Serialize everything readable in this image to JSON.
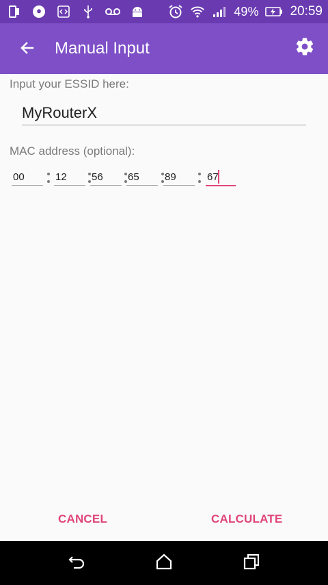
{
  "status_bar": {
    "battery": "49%",
    "time": "20:59",
    "left_icons": [
      "phone-icon",
      "soccer-ball-icon",
      "code-icon",
      "usb-icon",
      "voicemail-icon",
      "android-icon"
    ],
    "right_icons": [
      "alarm-icon",
      "wifi-icon",
      "signal-icon",
      "battery-charging-icon"
    ]
  },
  "app_bar": {
    "title": "Manual Input",
    "back_icon": "arrow-back-icon",
    "settings_icon": "gear-icon",
    "color": "#7e4fc7",
    "status_color": "#6a3bb0"
  },
  "form": {
    "essid_label": "Input your ESSID here:",
    "essid_value": "MyRouterX",
    "mac_label": "MAC address (optional):",
    "mac_octets": [
      "00",
      "12",
      "56",
      "65",
      "89",
      "67"
    ]
  },
  "actions": {
    "cancel": "CANCEL",
    "calculate": "CALCULATE",
    "accent": "#e0457b"
  },
  "nav_bar": {
    "icons": [
      "back-icon",
      "home-icon",
      "recents-icon"
    ]
  }
}
